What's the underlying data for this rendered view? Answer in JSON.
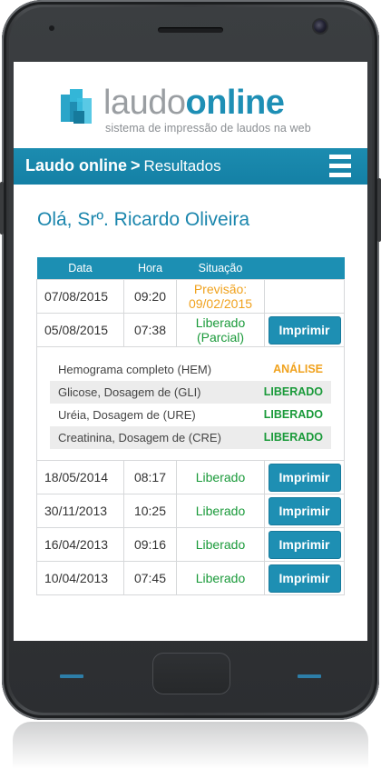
{
  "brand": {
    "word1": "laudo",
    "word2": "online",
    "tagline": "sistema de impressão de laudos na web"
  },
  "navbar": {
    "title": "Laudo online",
    "separator": ">",
    "section": "Resultados",
    "menu_icon": "hamburger-menu-icon"
  },
  "greeting": "Olá, Srº. Ricardo Oliveira",
  "table": {
    "headers": [
      "Data",
      "Hora",
      "Situação",
      ""
    ],
    "rows": [
      {
        "date": "07/08/2015",
        "time": "09:20",
        "status_line1": "Previsão:",
        "status_line2": "09/02/2015",
        "button": ""
      },
      {
        "date": "05/08/2015",
        "time": "07:38",
        "status_line1": "Liberado",
        "status_line2": "(Parcial)",
        "button": "Imprimir"
      }
    ],
    "exams": [
      {
        "name": "Hemograma completo (HEM)",
        "status": "ANÁLISE"
      },
      {
        "name": "Glicose, Dosagem de (GLI)",
        "status": "LIBERADO"
      },
      {
        "name": "Uréia, Dosagem de (URE)",
        "status": "LIBERADO"
      },
      {
        "name": "Creatinina, Dosagem de (CRE)",
        "status": "LIBERADO"
      }
    ],
    "more_rows": [
      {
        "date": "18/05/2014",
        "time": "08:17",
        "status": "Liberado",
        "button": "Imprimir"
      },
      {
        "date": "30/11/2013",
        "time": "10:25",
        "status": "Liberado",
        "button": "Imprimir"
      },
      {
        "date": "16/04/2013",
        "time": "09:16",
        "status": "Liberado",
        "button": "Imprimir"
      },
      {
        "date": "10/04/2013",
        "time": "07:45",
        "status": "Liberado",
        "button": "Imprimir"
      }
    ]
  },
  "colors": {
    "accent": "#1e8fb3",
    "pending": "#f0a21e",
    "released": "#1a9a3a"
  }
}
